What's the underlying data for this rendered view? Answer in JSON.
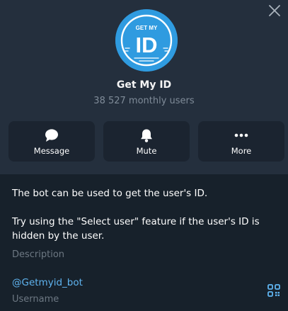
{
  "profile": {
    "avatar_small_text": "GET MY",
    "avatar_large_text": "ID",
    "name": "Get My ID",
    "subtitle": "38 527 monthly users"
  },
  "actions": [
    {
      "label": "Message",
      "icon": "message-bubble-icon"
    },
    {
      "label": "Mute",
      "icon": "bell-icon"
    },
    {
      "label": "More",
      "icon": "more-dots-icon"
    }
  ],
  "about": {
    "line1": "The bot can be used to get the user's ID.",
    "line2": "Try using the \"Select user\" feature if the user's ID is hidden by the user.",
    "caption": "Description"
  },
  "username": {
    "value": "@Getmyid_bot",
    "caption": "Username",
    "qr_icon": "qr-code-icon"
  },
  "icons": {
    "close": "close-icon"
  },
  "colors": {
    "panel_top": "#242f3d",
    "panel_bottom": "#17212b",
    "button_bg": "#1b2430",
    "avatar_bg": "#2f9be0",
    "link": "#5fb4f0",
    "muted": "#6d7883"
  }
}
